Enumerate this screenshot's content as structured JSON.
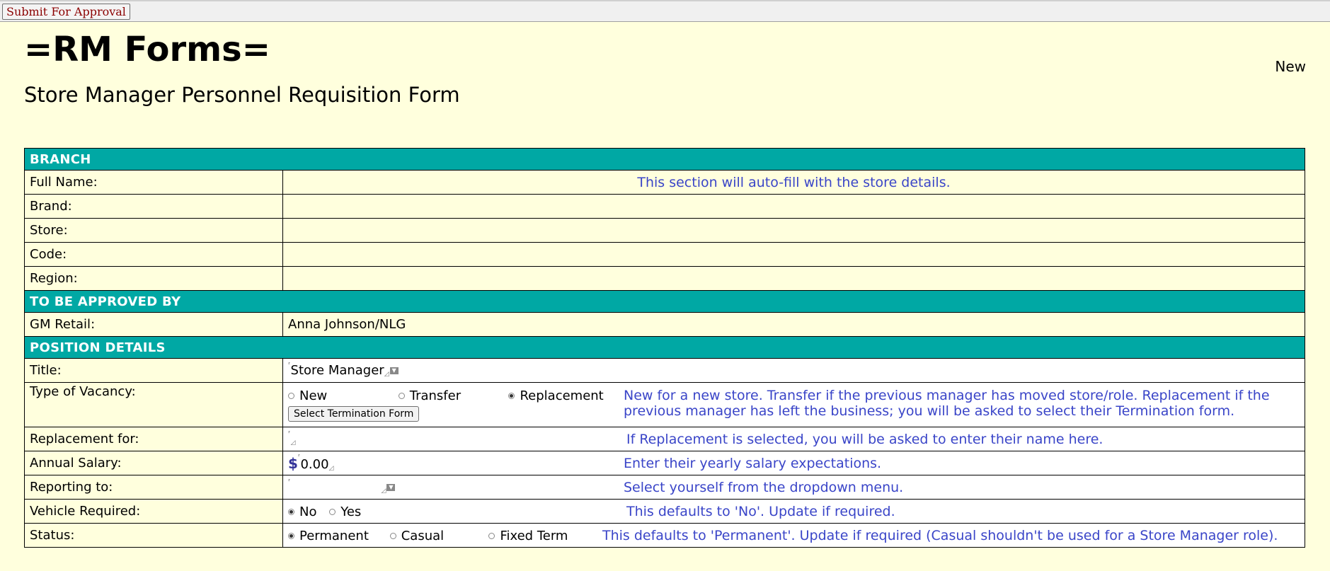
{
  "toolbar": {
    "submit_label": "Submit For Approval"
  },
  "header": {
    "title": "=RM Forms=",
    "status": "New",
    "form_title": "Store Manager Personnel Requisition Form"
  },
  "sections": {
    "branch": "BRANCH",
    "approved_by": "TO BE APPROVED BY",
    "position": "POSITION DETAILS"
  },
  "branch": {
    "full_name_label": "Full Name:",
    "brand_label": "Brand:",
    "store_label": "Store:",
    "code_label": "Code:",
    "region_label": "Region:",
    "autofill_hint": "This section will auto-fill with the store details."
  },
  "approval": {
    "gm_label": "GM Retail:",
    "gm_value": "Anna Johnson/NLG"
  },
  "position": {
    "title_label": "Title:",
    "title_value": "Store Manager",
    "vacancy_label": "Type of Vacancy:",
    "vacancy_options": [
      "New",
      "Transfer",
      "Replacement"
    ],
    "vacancy_selected": "Replacement",
    "select_termination_label": "Select Termination Form",
    "vacancy_hint": "New for a new store. Transfer if the previous manager has moved store/role. Replacement if the previous manager has left the business; you will be asked to select their Termination form.",
    "replacement_label": "Replacement for:",
    "replacement_value": "",
    "replacement_hint": "If Replacement is selected, you will be asked to enter their name here.",
    "salary_label": "Annual Salary:",
    "salary_currency": "$",
    "salary_value": "0.00",
    "salary_hint": "Enter their yearly salary expectations.",
    "reporting_label": "Reporting to:",
    "reporting_value": "",
    "reporting_hint": "Select yourself from the dropdown menu.",
    "vehicle_label": "Vehicle Required:",
    "vehicle_options": [
      "No",
      "Yes"
    ],
    "vehicle_selected": "No",
    "vehicle_hint": "This defaults to 'No'. Update if required.",
    "status_label": "Status:",
    "status_options": [
      "Permanent",
      "Casual",
      "Fixed Term"
    ],
    "status_selected": "Permanent",
    "status_hint": "This defaults to 'Permanent'. Update if required (Casual shouldn't be used for a Store Manager role)."
  },
  "colors": {
    "page_bg": "#ffffdd",
    "section_bg": "#00a8a4",
    "hint_text": "#3a45c8",
    "submit_text": "#8b0000"
  }
}
